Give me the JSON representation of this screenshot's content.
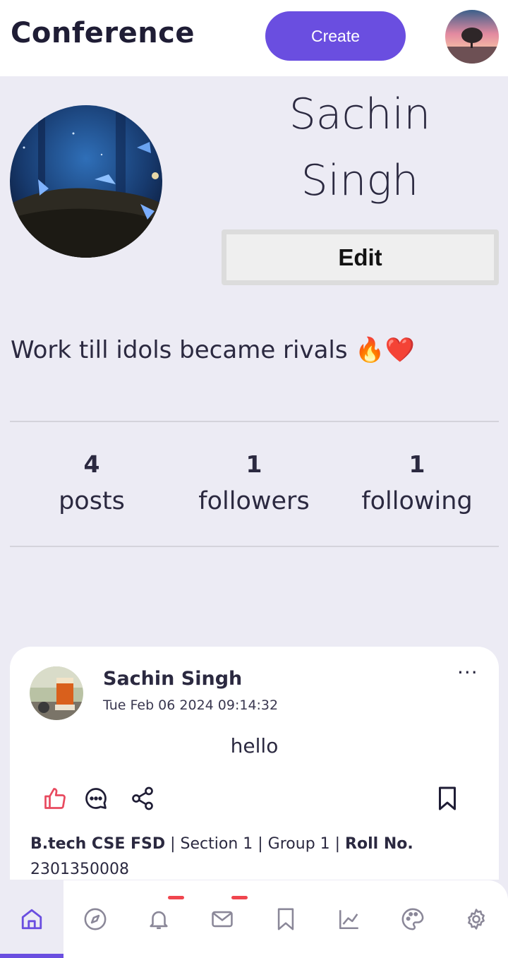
{
  "header": {
    "app_title": "Conference",
    "create_label": "Create"
  },
  "profile": {
    "name": "Sachin Singh",
    "edit_label": "Edit",
    "bio": "Work till idols became rivals 🔥❤️"
  },
  "stats": [
    {
      "value": "4",
      "label": "posts"
    },
    {
      "value": "1",
      "label": "followers"
    },
    {
      "value": "1",
      "label": "following"
    }
  ],
  "post": {
    "author": "Sachin Singh",
    "date": "Tue Feb 06 2024 09:14:32",
    "more": "···",
    "text": "hello",
    "meta_program": "B.tech CSE FSD",
    "meta_section": " | Section 1 | Group 1 | ",
    "meta_roll_label": "Roll No.",
    "meta_roll_value": "2301350008",
    "icons": [
      "like-icon",
      "comment-icon",
      "share-icon",
      "bookmark-icon"
    ]
  },
  "nav": {
    "items": [
      "home-icon",
      "explore-icon",
      "notifications-icon",
      "messages-icon",
      "bookmarks-icon",
      "analytics-icon",
      "theme-icon",
      "settings-icon"
    ],
    "active": "home-icon",
    "badges": [
      "notifications-icon",
      "messages-icon"
    ]
  },
  "colors": {
    "accent": "#6a4ee0",
    "background": "#ecebf4",
    "like": "#e84a5f",
    "badge": "#f0454e"
  }
}
